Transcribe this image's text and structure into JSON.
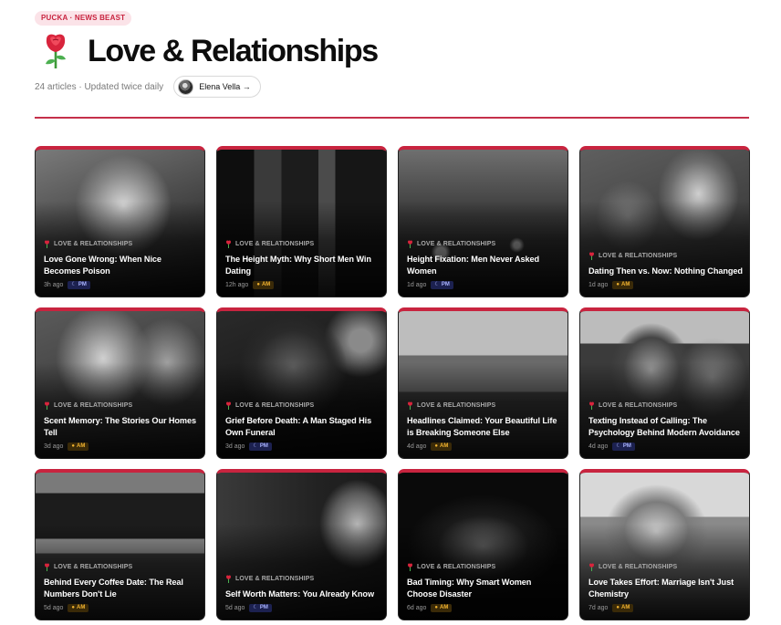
{
  "header": {
    "badge": "PUCKA · NEWS BEAST",
    "title": "Love & Relationships",
    "meta": "24 articles · Updated twice daily",
    "author": "Elena Vella →"
  },
  "colors": {
    "accent": "#c8243f",
    "am_badge": "#f0b230",
    "pm_badge": "#aab4ff"
  },
  "icons": {
    "category": "rose-icon",
    "am": "sun-icon",
    "pm": "moon-icon"
  },
  "articles": [
    {
      "category": "LOVE & RELATIONSHIPS",
      "title": "Love Gone Wrong: When Nice Becomes Poison",
      "time": "3h ago",
      "period": "PM"
    },
    {
      "category": "LOVE & RELATIONSHIPS",
      "title": "The Height Myth: Why Short Men Win Dating",
      "time": "12h ago",
      "period": "AM"
    },
    {
      "category": "LOVE & RELATIONSHIPS",
      "title": "Height Fixation: Men Never Asked Women",
      "time": "1d ago",
      "period": "PM"
    },
    {
      "category": "LOVE & RELATIONSHIPS",
      "title": "Dating Then vs. Now: Nothing Changed",
      "time": "1d ago",
      "period": "AM"
    },
    {
      "category": "LOVE & RELATIONSHIPS",
      "title": "Scent Memory: The Stories Our Homes Tell",
      "time": "3d ago",
      "period": "AM"
    },
    {
      "category": "LOVE & RELATIONSHIPS",
      "title": "Grief Before Death: A Man Staged His Own Funeral",
      "time": "3d ago",
      "period": "PM"
    },
    {
      "category": "LOVE & RELATIONSHIPS",
      "title": "Headlines Claimed: Your Beautiful Life is Breaking Someone Else",
      "time": "4d ago",
      "period": "AM"
    },
    {
      "category": "LOVE & RELATIONSHIPS",
      "title": "Texting Instead of Calling: The Psychology Behind Modern Avoidance",
      "time": "4d ago",
      "period": "PM"
    },
    {
      "category": "LOVE & RELATIONSHIPS",
      "title": "Behind Every Coffee Date: The Real Numbers Don't Lie",
      "time": "5d ago",
      "period": "AM"
    },
    {
      "category": "LOVE & RELATIONSHIPS",
      "title": "Self Worth Matters: You Already Know",
      "time": "5d ago",
      "period": "PM"
    },
    {
      "category": "LOVE & RELATIONSHIPS",
      "title": "Bad Timing: Why Smart Women Choose Disaster",
      "time": "6d ago",
      "period": "AM"
    },
    {
      "category": "LOVE & RELATIONSHIPS",
      "title": "Love Takes Effort: Marriage Isn't Just Chemistry",
      "time": "7d ago",
      "period": "AM"
    }
  ]
}
